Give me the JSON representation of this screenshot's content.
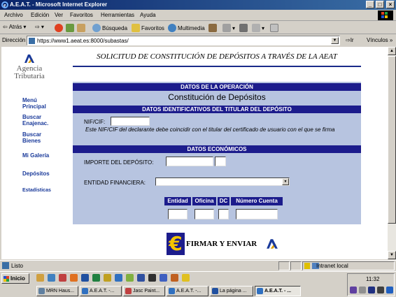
{
  "window": {
    "title": "A.E.A.T. - Microsoft Internet Explorer",
    "buttons": [
      "_",
      "□",
      "×"
    ]
  },
  "menu": [
    "Archivo",
    "Edición",
    "Ver",
    "Favoritos",
    "Herramientas",
    "Ayuda"
  ],
  "toolbar": {
    "back": "Atrás",
    "search": "Búsqueda",
    "favorites": "Favoritos",
    "multimedia": "Multimedia"
  },
  "address": {
    "label": "Dirección",
    "url": "https://www1.aeat.es:8000/subastas/",
    "go": "Ir",
    "links": "Vínculos »"
  },
  "logo": {
    "line1": "Agencia",
    "line2": "Tributaria"
  },
  "nav": [
    {
      "label": "Menú Principal"
    },
    {
      "label": "Buscar Enajenac."
    },
    {
      "label": "Buscar Bienes"
    },
    {
      "label": "Mi Galería"
    },
    {
      "label": "Depósitos"
    },
    {
      "label": "Estadísticas"
    }
  ],
  "page": {
    "title": "SOLICITUD DE CONSTITUCIÓN DE DEPÓSITOS A TRAVÉS DE LA AEAT"
  },
  "form": {
    "section1": "DATOS DE LA OPERACIÓN",
    "operation": "Constitución de Depósitos",
    "section2": "DATOS IDENTIFICATIVOS DEL TITULAR DEL DEPÓSITO",
    "nif_label": "NIF/CIF:",
    "nif_value": "",
    "nif_note": "Este NIF/CIF del declarante debe coincidir con el titular del certificado de usuario con el que se firma",
    "section3": "DATOS ECONÓMICOS",
    "amount_label": "IMPORTE DEL DEPÓSITO:",
    "amount_value": "",
    "bank_label": "ENTIDAD FINANCIERA:",
    "bank_value": "",
    "ccc_headers": [
      "Entidad",
      "Oficina",
      "DC",
      "Número Cuenta"
    ]
  },
  "submit": {
    "label": "FIRMAR Y ENVIAR",
    "euro": "€"
  },
  "status": {
    "text": "Listo",
    "zone": "Intranet local"
  },
  "taskbar": {
    "start": "Inicio",
    "tasks": [
      {
        "label": "MRN Haus..."
      },
      {
        "label": "A.E.A.T. -..."
      },
      {
        "label": "Jasc Paint..."
      },
      {
        "label": "A.E.A.T. -..."
      },
      {
        "label": "La página ..."
      },
      {
        "label": "A.E.A.T. - ..."
      }
    ],
    "clock": "11:32"
  },
  "colors": {
    "accent": "#1c1c8c",
    "form_bg": "#b7c4e0",
    "nav_link": "#1a3a9a",
    "title_bar": "#0a246a"
  }
}
